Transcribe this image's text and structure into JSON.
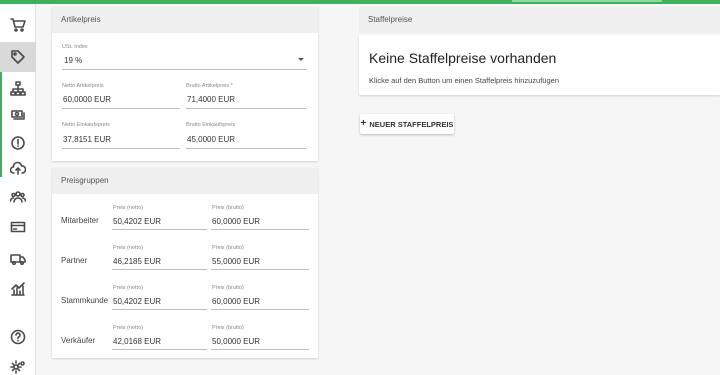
{
  "nav": {
    "items": [
      {
        "icon": "cart-icon"
      },
      {
        "icon": "tag-icon",
        "active": true
      },
      {
        "icon": "hierarchy-icon"
      },
      {
        "icon": "coins-icon"
      },
      {
        "icon": "alert-icon"
      },
      {
        "icon": "cloud-upload-icon"
      },
      {
        "icon": "users-icon"
      },
      {
        "icon": "credit-card-icon"
      },
      {
        "icon": "truck-icon"
      },
      {
        "icon": "analytics-icon"
      },
      {
        "icon": "help-icon"
      },
      {
        "icon": "settings-icon"
      }
    ],
    "accent_color": "#3cb35a"
  },
  "artikelpreis": {
    "header": "Artikelpreis",
    "ust_label": "USt. Index",
    "ust_value": "19 %",
    "netto_artikel_label": "Netto Artikelpreis",
    "netto_artikel_value": "60,0000 EUR",
    "brutto_artikel_label": "Brutto Artikelpreis *",
    "brutto_artikel_value": "71,4000 EUR",
    "netto_einkauf_label": "Netto Einkaufspreis",
    "netto_einkauf_value": "37,8151 EUR",
    "brutto_einkauf_label": "Brutto Einkaufspreis",
    "brutto_einkauf_value": "45,0000 EUR"
  },
  "preisgruppen": {
    "header": "Preisgruppen",
    "netto_label": "Preis (netto)",
    "brutto_label": "Preis (brutto)",
    "rows": [
      {
        "name": "Mitarbeiter",
        "netto": "50,4202 EUR",
        "brutto": "60,0000 EUR"
      },
      {
        "name": "Partner",
        "netto": "46,2185 EUR",
        "brutto": "55,0000 EUR"
      },
      {
        "name": "Stammkunde",
        "netto": "50,4202 EUR",
        "brutto": "60,0000 EUR"
      },
      {
        "name": "Verkäufer",
        "netto": "42,0168 EUR",
        "brutto": "50,0000 EUR"
      }
    ]
  },
  "staffelpreise": {
    "header": "Staffelpreise",
    "empty_title": "Keine Staffelpreise vorhanden",
    "empty_desc": "Klicke auf den Button um einen Staffelpreis hinzuzufügen",
    "button_label": "NEUER STAFFELPREIS"
  }
}
